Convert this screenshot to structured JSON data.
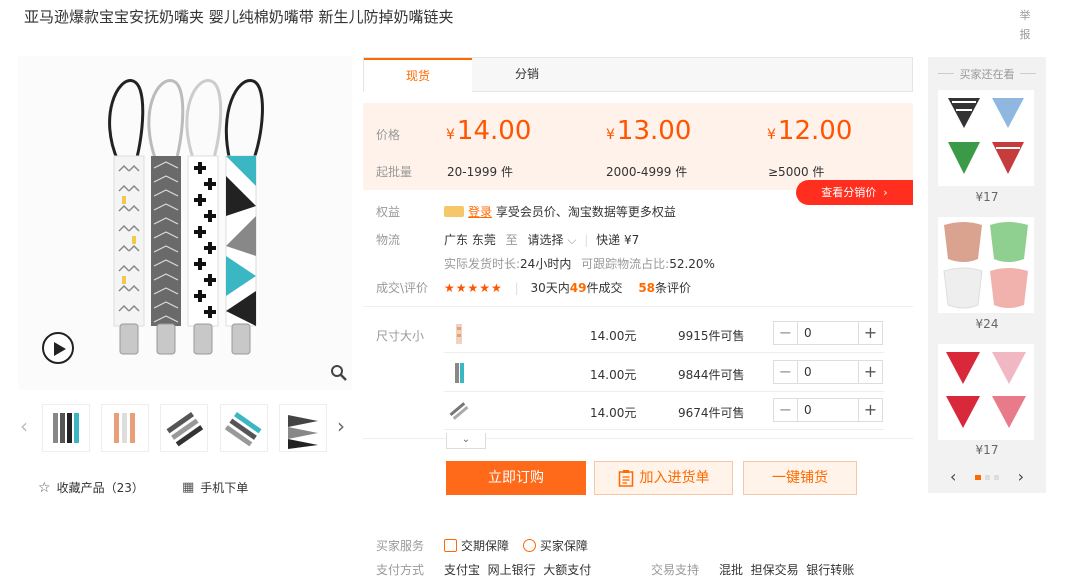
{
  "product": {
    "title": "亚马逊爆款宝宝安抚奶嘴夹 婴儿纯棉奶嘴带 新生儿防掉奶嘴链夹",
    "report_label": "举报"
  },
  "gallery": {
    "favorite_label": "收藏产品（23）",
    "mobile_label": "手机下单"
  },
  "tabs": [
    {
      "label": "现货"
    },
    {
      "label": "分销"
    }
  ],
  "pricing": {
    "price_label": "价格",
    "qty_label": "起批量",
    "currency": "¥",
    "tiers": [
      {
        "price": "14.00",
        "qty": "20-1999 件"
      },
      {
        "price": "13.00",
        "qty": "2000-4999 件"
      },
      {
        "price": "12.00",
        "qty": "≥5000 件"
      }
    ],
    "distribution_button": "查看分销价"
  },
  "benefits": {
    "label": "权益",
    "login_link": "登录",
    "text": "享受会员价、淘宝数据等更多权益"
  },
  "logistics": {
    "label": "物流",
    "origin": "广东 东莞",
    "to": "至",
    "destination": "请选择",
    "shipping": "快递 ¥7",
    "ship_time_label": "实际发货时长:",
    "ship_time": "24小时内",
    "track_label": "可跟踪物流占比:",
    "track_rate": "52.20%"
  },
  "reviews": {
    "label": "成交\\评价",
    "stars": "★★★★★",
    "sales_prefix": "30天内",
    "sales_count": "49",
    "sales_suffix": "件成交",
    "review_count": "58",
    "review_suffix": "条评价"
  },
  "sku": {
    "label": "尺寸大小",
    "rows": [
      {
        "price": "14.00元",
        "stock": "9915件可售",
        "qty": "0"
      },
      {
        "price": "14.00元",
        "stock": "9844件可售",
        "qty": "0"
      },
      {
        "price": "14.00元",
        "stock": "9674件可售",
        "qty": "0"
      }
    ]
  },
  "actions": {
    "buy": "立即订购",
    "add_cart": "加入进货单",
    "one_click": "一键铺货"
  },
  "services": {
    "label": "买家服务",
    "items": [
      "交期保障",
      "买家保障"
    ]
  },
  "payment": {
    "label": "支付方式",
    "methods": "支付宝  网上银行  大额支付",
    "support_label": "交易支持",
    "support": "混批  担保交易  银行转账"
  },
  "sidebar": {
    "title": "买家还在看",
    "items": [
      {
        "price": "¥17"
      },
      {
        "price": "¥24"
      },
      {
        "price": "¥17"
      }
    ]
  }
}
